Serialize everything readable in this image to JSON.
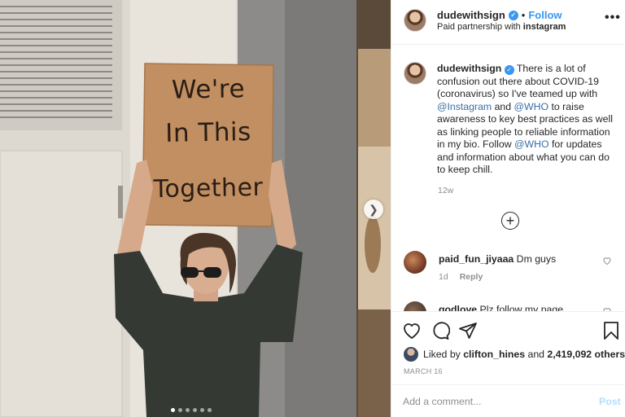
{
  "post": {
    "sign_lines": [
      "We're",
      "In This",
      "Together"
    ],
    "carousel": {
      "slides": 6,
      "active_index": 0
    }
  },
  "header": {
    "username": "dudewithsign",
    "separator": "•",
    "follow_label": "Follow",
    "partnership_prefix": "Paid partnership with",
    "partner": "instagram",
    "more_label": "•••"
  },
  "caption": {
    "username": "dudewithsign",
    "text_1": " There is a lot of confusion out there about COVID-19 (coronavirus) so I've teamed up with ",
    "mention_1": "@Instagram",
    "text_2": " and ",
    "mention_2": "@WHO",
    "text_3": " to raise awareness to key best practices as well as linking people to reliable information in my bio. Follow ",
    "mention_3": "@WHO",
    "text_4": " for updates and information about what you can do to keep chill.",
    "time": "12w"
  },
  "comments": [
    {
      "username": "paid_fun_jiyaaa",
      "text": " Dm guys",
      "time": "1d",
      "reply_label": "Reply"
    },
    {
      "username": "godlove",
      "text": " Plz follow my page",
      "time": "",
      "reply_label": ""
    }
  ],
  "likes": {
    "prefix": "Liked by ",
    "user": "clifton_hines",
    "middle": " and ",
    "count": "2,419,092 others"
  },
  "date": "MARCH 16",
  "add_comment": {
    "placeholder": "Add a comment...",
    "post_label": "Post"
  },
  "colors": {
    "accent": "#3897f0",
    "post_disabled": "#b2dffc",
    "muted": "#8e8e8e",
    "text": "#262626"
  },
  "icons": [
    "verified-badge-icon",
    "more-options-icon",
    "load-more-icon",
    "heart-icon",
    "comment-icon",
    "share-icon",
    "bookmark-icon",
    "next-arrow-icon"
  ]
}
